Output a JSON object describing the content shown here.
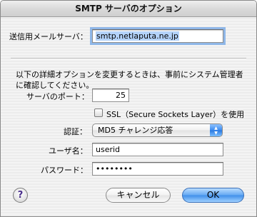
{
  "window": {
    "title": "SMTP サーバのオプション"
  },
  "server": {
    "label": "送信用メールサーバ：",
    "value": "smtp.netlaputa.ne.jp"
  },
  "details": {
    "text": "以下の詳細オプションを変更するときは、事前にシステム管理者に確認してください。"
  },
  "port": {
    "label": "サーバのポート：",
    "value": "25"
  },
  "ssl": {
    "label": "SSL（Secure Sockets Layer）を使用",
    "checked": false
  },
  "auth": {
    "label": "認証：",
    "selected": "MD5 チャレンジ応答"
  },
  "username": {
    "label": "ユーザ名：",
    "value": "userid"
  },
  "password": {
    "label": "パスワード：",
    "value": "••••••••"
  },
  "buttons": {
    "help": "?",
    "cancel": "キャンセル",
    "ok": "OK"
  },
  "colors": {
    "focus_ring": "#8fb7e8",
    "default_button": "#3f8eea",
    "popup_arrows": "#2a78e0"
  },
  "icons": {
    "help": "help-icon",
    "popup": "up-down-arrows-icon"
  }
}
